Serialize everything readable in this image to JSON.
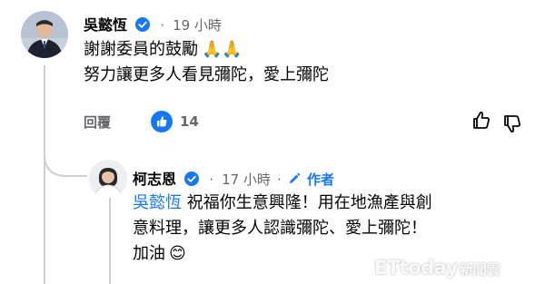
{
  "comment1": {
    "author": "吳懿恆",
    "time": "19 小時",
    "line1": "謝謝委員的鼓勵",
    "emoji1": "🙏🙏",
    "line2": "努力讓更多人看見彌陀，愛上彌陀",
    "reply_label": "回覆",
    "like_count": "14"
  },
  "comment2": {
    "author": "柯志恩",
    "time": "17 小時",
    "author_badge": "作者",
    "mention": "吳懿恆",
    "line1": " 祝福你生意興隆！用在地漁產與創",
    "line2": "意料理，讓更多人認識彌陀、愛上彌陀！",
    "line3": "加油",
    "emoji": "😊"
  },
  "watermark": {
    "brand": "ETtoday",
    "suffix": "新聞雲"
  },
  "colors": {
    "accent": "#1877f2",
    "meta": "#65676b",
    "text": "#050505"
  }
}
